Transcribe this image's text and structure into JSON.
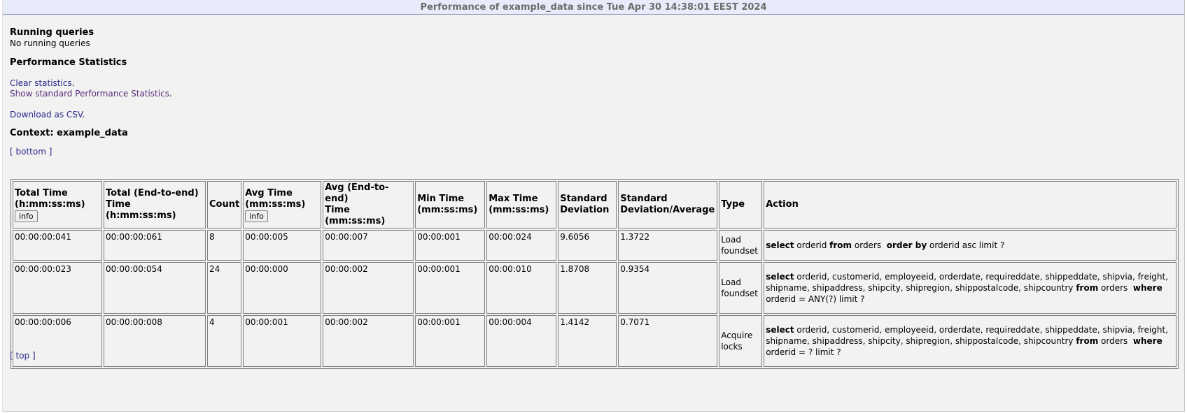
{
  "window": {
    "title": "Performance of example_data since Tue Apr 30 14:38:01 EEST 2024"
  },
  "running": {
    "heading": "Running queries",
    "status": "No running queries"
  },
  "performance": {
    "heading": "Performance Statistics"
  },
  "links": {
    "clear_label": "Clear statistics",
    "standard_label": "Show standard Performance Statistics",
    "download_label": "Download as CSV",
    "period": "."
  },
  "context": {
    "heading": "Context: example_data"
  },
  "nav": {
    "bottom": "[ bottom ]",
    "top": "[ top ]"
  },
  "table": {
    "headers": {
      "total_time": [
        "Total Time",
        "(h:mm:ss:ms)"
      ],
      "total_e2e": [
        "Total (End-to-end)",
        "Time (h:mm:ss:ms)"
      ],
      "count": "Count",
      "avg_time": [
        "Avg Time",
        "(mm:ss:ms)"
      ],
      "avg_e2e": [
        "Avg (End-to-end)",
        "Time (mm:ss:ms)"
      ],
      "min_time": [
        "Min Time",
        "(mm:ss:ms)"
      ],
      "max_time": [
        "Max Time",
        "(mm:ss:ms)"
      ],
      "std_dev": [
        "Standard",
        "Deviation"
      ],
      "std_avg": [
        "Standard",
        "Deviation/Average"
      ],
      "type": "Type",
      "action": "Action",
      "info_button": "info"
    },
    "rows": [
      {
        "total": "00:00:00:041",
        "total_e2e": "00:00:00:061",
        "count": "8",
        "avg": "00:00:005",
        "avg_e2e": "00:00:007",
        "min": "00:00:001",
        "max": "00:00:024",
        "std": "9.6056",
        "std_avg": "1.3722",
        "type": "Load foundset",
        "action": {
          "kw1": "select",
          "cols": " orderid ",
          "kw2": "from",
          "tbl": " orders  ",
          "kw3": "order by",
          "rest": " orderid asc limit ?"
        }
      },
      {
        "total": "00:00:00:023",
        "total_e2e": "00:00:00:054",
        "count": "24",
        "avg": "00:00:000",
        "avg_e2e": "00:00:002",
        "min": "00:00:001",
        "max": "00:00:010",
        "std": "1.8708",
        "std_avg": "0.9354",
        "type": "Load foundset",
        "action": {
          "kw1": "select",
          "cols": " orderid, customerid, employeeid, orderdate, requireddate, shippeddate, shipvia, freight, shipname, shipaddress, shipcity, shipregion, shippostalcode, shipcountry ",
          "kw2": "from",
          "tbl": " orders  ",
          "kw3": "where",
          "rest": " orderid = ANY(?) limit ?"
        }
      },
      {
        "total": "00:00:00:006",
        "total_e2e": "00:00:00:008",
        "count": "4",
        "avg": "00:00:001",
        "avg_e2e": "00:00:002",
        "min": "00:00:001",
        "max": "00:00:004",
        "std": "1.4142",
        "std_avg": "0.7071",
        "type": "Acquire locks",
        "action": {
          "kw1": "select",
          "cols": " orderid, customerid, employeeid, orderdate, requireddate, shippeddate, shipvia, freight, shipname, shipaddress, shipcity, shipregion, shippostalcode, shipcountry ",
          "kw2": "from",
          "tbl": " orders  ",
          "kw3": "where",
          "rest": " orderid = ? limit ?"
        }
      }
    ]
  }
}
